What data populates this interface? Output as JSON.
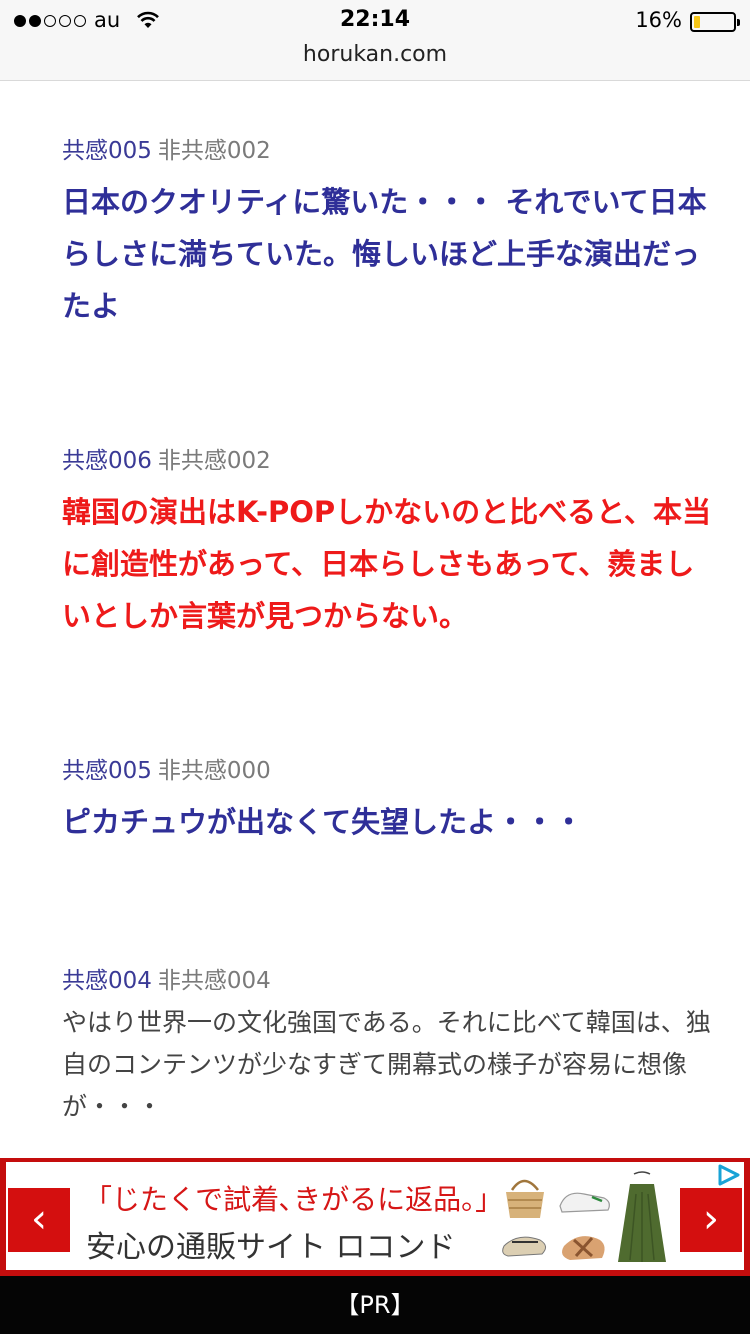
{
  "status_bar": {
    "carrier": "au",
    "time": "22:14",
    "battery_percent": "16%",
    "battery_level": 0.16,
    "signal_bars_filled": 2,
    "signal_bars_total": 5,
    "url": "horukan.com"
  },
  "comments": [
    {
      "likes": "共感005",
      "dislikes": "非共感002",
      "text": "日本のクオリティに驚いた・・・ それでいて日本らしさに満ちていた。悔しいほど上手な演出だったよ",
      "style": "blue-bold"
    },
    {
      "likes": "共感006",
      "dislikes": "非共感002",
      "text": "韓国の演出はK-POPしかないのと比べると、本当に創造性があって、日本らしさもあって、羨ましいとしか言葉が見つからない。",
      "style": "red-bold"
    },
    {
      "likes": "共感005",
      "dislikes": "非共感000",
      "text": "ピカチュウが出なくて失望したよ・・・",
      "style": "blue-bold"
    },
    {
      "likes": "共感004",
      "dislikes": "非共感004",
      "text": "やはり世界一の文化強国である。それに比べて韓国は、独自のコンテンツが少なすぎて開幕式の様子が容易に想像が・・・",
      "style": "plain"
    }
  ],
  "ad": {
    "headline": "「じたくで試着､きがるに返品。」",
    "subline": "安心の通販サイト ロコンド",
    "prev_icon": "chevron-left-icon",
    "next_icon": "chevron-right-icon",
    "accent_color": "#c40d0d"
  },
  "pr_label": "【PR】"
}
